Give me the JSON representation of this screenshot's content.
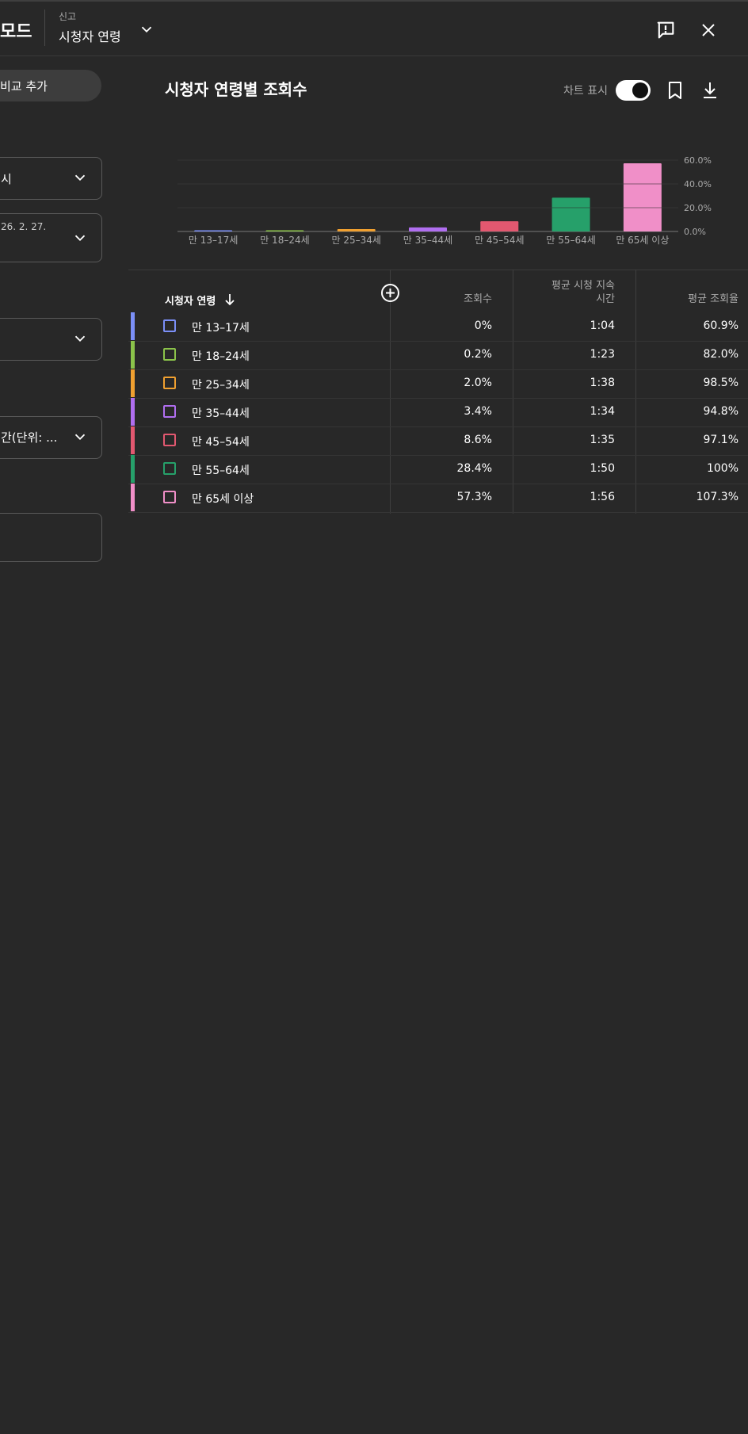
{
  "header": {
    "mode_title": "모드",
    "report_caption": "신고",
    "report_value": "시청자 연령"
  },
  "left_panel": {
    "add_button": "비교 추가",
    "dropdown1_value": "시",
    "date_value": "26. 2. 27.",
    "dropdown4_value": "간(단위: ..."
  },
  "chart_panel": {
    "title": "시청자 연령별 조회수",
    "toggle_label": "차트 표시",
    "toggle_on": true
  },
  "chart_data": {
    "type": "bar",
    "categories": [
      "만 13–17세",
      "만 18–24세",
      "만 25–34세",
      "만 35–44세",
      "만 45–54세",
      "만 55–64세",
      "만 65세 이상"
    ],
    "values": [
      0,
      0.2,
      2.0,
      3.4,
      8.6,
      28.4,
      57.3
    ],
    "colors": [
      "#7b8ff7",
      "#8bc34a",
      "#f0a030",
      "#b06ef0",
      "#e25870",
      "#26a06a",
      "#f08fc8"
    ],
    "yticks": [
      "0.0%",
      "20.0%",
      "40.0%",
      "60.0%"
    ],
    "ylim": [
      0,
      60
    ],
    "grid": true
  },
  "table": {
    "headers": {
      "age": "시청자 연령",
      "views": "조회수",
      "avg_duration_line1": "평균 시청 지속",
      "avg_duration_line2": "시간",
      "avg_pct": "평균 조회율"
    },
    "rows": [
      {
        "age": "만 13–17세",
        "views": "0%",
        "duration": "1:04",
        "pct": "60.9%",
        "color": "#7b8ff7"
      },
      {
        "age": "만 18–24세",
        "views": "0.2%",
        "duration": "1:23",
        "pct": "82.0%",
        "color": "#8bc34a"
      },
      {
        "age": "만 25–34세",
        "views": "2.0%",
        "duration": "1:38",
        "pct": "98.5%",
        "color": "#f0a030"
      },
      {
        "age": "만 35–44세",
        "views": "3.4%",
        "duration": "1:34",
        "pct": "94.8%",
        "color": "#b06ef0"
      },
      {
        "age": "만 45–54세",
        "views": "8.6%",
        "duration": "1:35",
        "pct": "97.1%",
        "color": "#e25870"
      },
      {
        "age": "만 55–64세",
        "views": "28.4%",
        "duration": "1:50",
        "pct": "100%",
        "color": "#26a06a"
      },
      {
        "age": "만 65세 이상",
        "views": "57.3%",
        "duration": "1:56",
        "pct": "107.3%",
        "color": "#f08fc8"
      }
    ]
  },
  "icons": {
    "dropdown": "chevron-down-icon",
    "feedback": "feedback-icon",
    "close": "close-icon",
    "bookmark": "bookmark-icon",
    "download": "download-icon",
    "sort": "arrow-down-icon",
    "add_column": "add-circle-icon"
  }
}
